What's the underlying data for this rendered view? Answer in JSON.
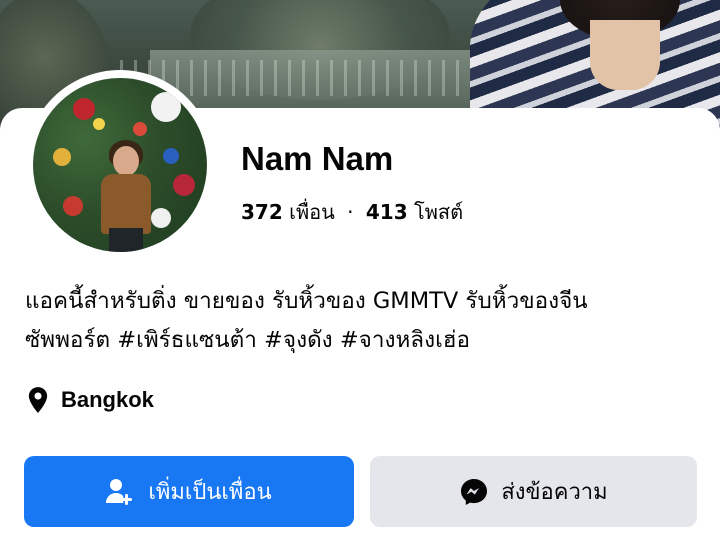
{
  "profile": {
    "name": "Nam Nam",
    "friends_count": "372",
    "friends_label": "เพื่อน",
    "separator": "·",
    "posts_count": "413",
    "posts_label": "โพสต์",
    "bio_lines": [
      "แอคนี้สำหรับติ่ง ขายของ รับหิ้วของ GMMTV รับหิ้วของจีน",
      "ซัพพอร์ต #เพิร์ธแซนต้า #จุงดัง #จางหลิงเฮ่อ"
    ],
    "location": "Bangkok"
  },
  "actions": {
    "add_friend_label": "เพิ่มเป็นเพื่อน",
    "message_label": "ส่งข้อความ"
  },
  "colors": {
    "primary_button": "#1877f2",
    "secondary_button": "#e4e6eb",
    "text": "#050505"
  },
  "icons": {
    "location": "location-pin-icon",
    "add_friend": "add-friend-icon",
    "message": "messenger-icon"
  }
}
